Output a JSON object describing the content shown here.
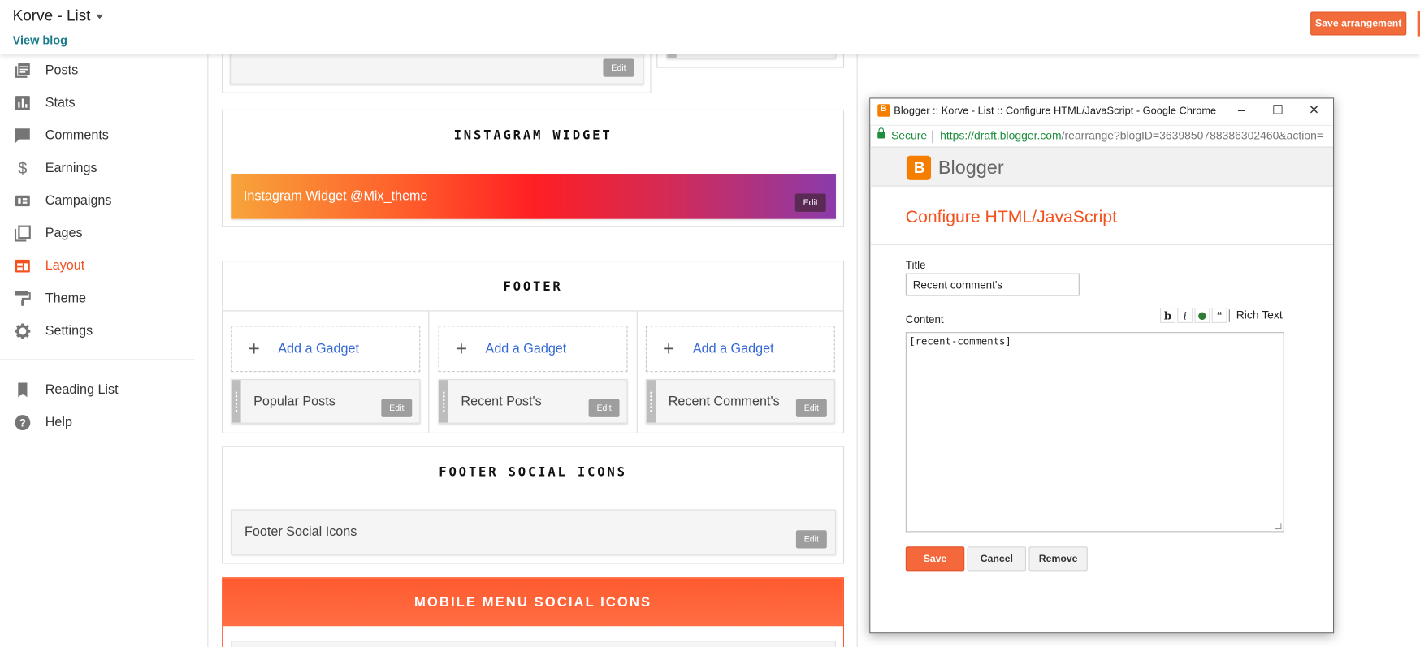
{
  "header": {
    "blog_title": "Korve - List",
    "view_blog": "View blog",
    "save_arrangement": "Save arrangement"
  },
  "sidebar": {
    "items": [
      {
        "label": "Posts",
        "icon": "posts-icon"
      },
      {
        "label": "Stats",
        "icon": "stats-icon"
      },
      {
        "label": "Comments",
        "icon": "comments-icon"
      },
      {
        "label": "Earnings",
        "icon": "dollar-icon"
      },
      {
        "label": "Campaigns",
        "icon": "campaigns-icon"
      },
      {
        "label": "Pages",
        "icon": "pages-icon"
      },
      {
        "label": "Layout",
        "icon": "layout-icon",
        "active": true
      },
      {
        "label": "Theme",
        "icon": "paint-roller-icon"
      },
      {
        "label": "Settings",
        "icon": "gear-icon"
      }
    ],
    "secondary": [
      {
        "label": "Reading List",
        "icon": "bookmark-icon"
      },
      {
        "label": "Help",
        "icon": "help-icon"
      }
    ],
    "active_color": "#f4511e"
  },
  "layout": {
    "edit_label": "Edit",
    "instagram": {
      "title": "INSTAGRAM WIDGET",
      "gadget": "Instagram Widget @Mix_theme"
    },
    "footer": {
      "title": "FOOTER",
      "add_gadget": "Add a Gadget",
      "gadgets": [
        "Popular Posts",
        "Recent Post's",
        "Recent Comment's"
      ]
    },
    "footer_social": {
      "title": "FOOTER SOCIAL ICONS",
      "gadget": "Footer Social Icons"
    },
    "mobile_menu": {
      "title": "MOBILE MENU SOCIAL ICONS"
    }
  },
  "popup": {
    "window_title": "Blogger :: Korve - List :: Configure HTML/JavaScript - Google Chrome",
    "secure": "Secure",
    "url_host": "https://draft.blogger.com",
    "url_path": "/rearrange?blogID=3639850788386302460&action=",
    "brand": "Blogger",
    "heading": "Configure HTML/JavaScript",
    "title_label": "Title",
    "title_value": "Recent comment's",
    "content_label": "Content",
    "rich_text": "Rich Text",
    "content_value": "[recent-comments]",
    "save": "Save",
    "cancel": "Cancel",
    "remove": "Remove"
  },
  "colors": {
    "accent": "#f26b3a",
    "instagram_gradient": [
      "#f7a43a",
      "#ff1f24",
      "#8a3bab"
    ],
    "mobile_menu": "#ff5a2e"
  }
}
